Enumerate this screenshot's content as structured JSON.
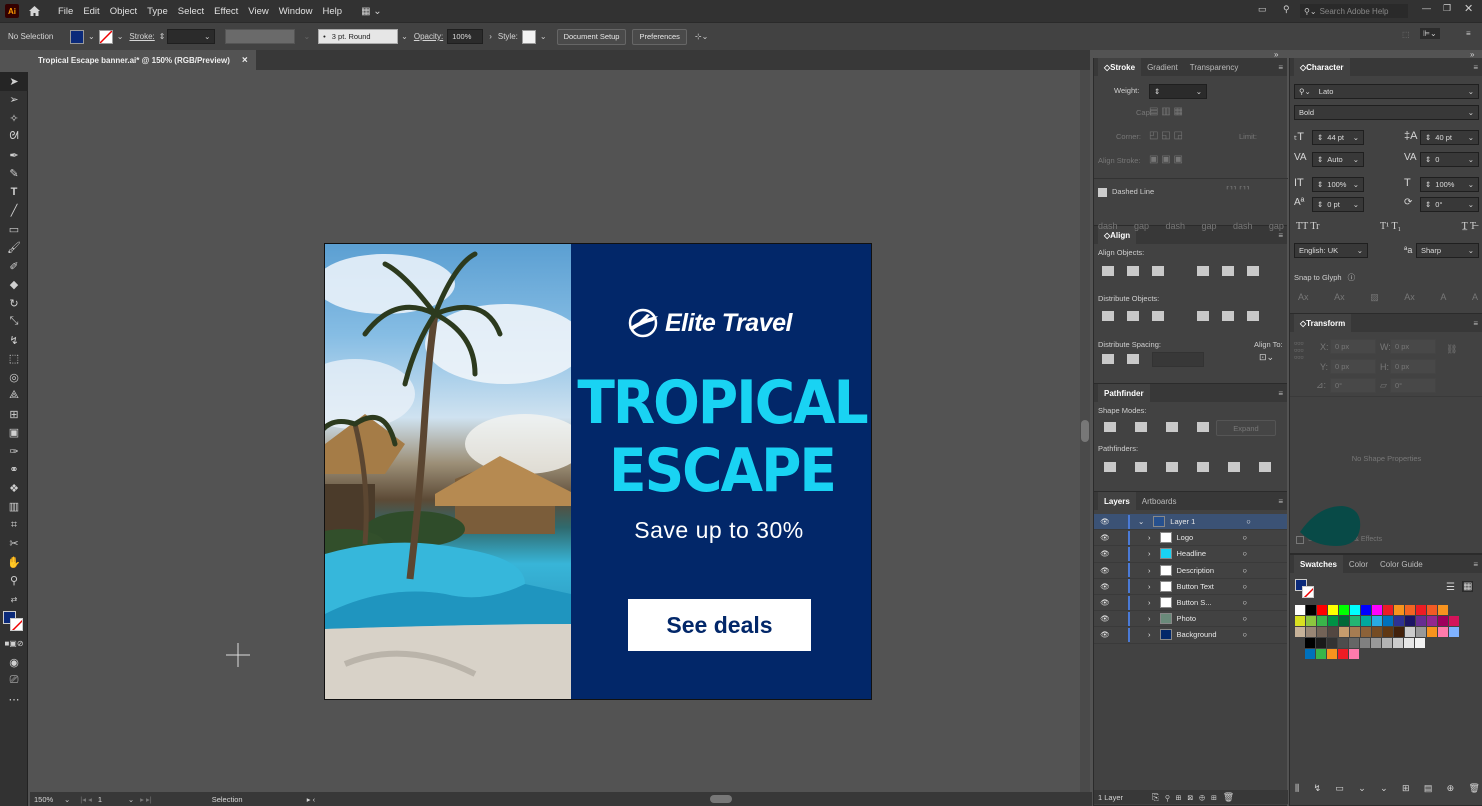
{
  "app": {
    "logo_text": "Ai"
  },
  "menu": [
    "File",
    "Edit",
    "Object",
    "Type",
    "Select",
    "Effect",
    "View",
    "Window",
    "Help"
  ],
  "search": {
    "placeholder": "Search Adobe Help"
  },
  "control_bar": {
    "selection_label": "No Selection",
    "stroke_label": "Stroke:",
    "brush": "3 pt. Round",
    "opacity_label": "Opacity:",
    "opacity_value": "100%",
    "style_label": "Style:",
    "document_setup": "Document Setup",
    "preferences": "Preferences",
    "fill_color": "#0b2a7a"
  },
  "document_tab": {
    "title": "Tropical Escape banner.ai* @ 150% (RGB/Preview)",
    "close": "×"
  },
  "banner": {
    "brand": "Elite Travel",
    "headline_line1": "TROPICAL",
    "headline_line2": "ESCAPE",
    "description": "Save up to 30%",
    "button_text": "See deals",
    "bg_color": "#022769",
    "headline_color": "#19d3f3"
  },
  "status": {
    "zoom": "150%",
    "artboard": "1",
    "tool": "Selection"
  },
  "stroke_panel": {
    "tabs": [
      "Stroke",
      "Gradient",
      "Transparency"
    ],
    "weight_label": "Weight:",
    "cap_label": "Cap:",
    "corner_label": "Corner:",
    "limit_label": "Limit:",
    "align_stroke_label": "Align Stroke:",
    "dashed_line": "Dashed Line",
    "dash_labels": [
      "dash",
      "gap",
      "dash",
      "gap",
      "dash",
      "gap"
    ]
  },
  "align_panel": {
    "title": "Align",
    "align_objects": "Align Objects:",
    "distribute_objects": "Distribute Objects:",
    "distribute_spacing": "Distribute Spacing:",
    "align_to": "Align To:"
  },
  "pathfinder_panel": {
    "title": "Pathfinder",
    "shape_modes": "Shape Modes:",
    "expand": "Expand",
    "pathfinders": "Pathfinders:"
  },
  "layers_panel": {
    "tabs": [
      "Layers",
      "Artboards"
    ],
    "layers": [
      {
        "name": "Layer 1",
        "level": 0
      },
      {
        "name": "Logo",
        "level": 1
      },
      {
        "name": "Headline",
        "level": 1
      },
      {
        "name": "Description",
        "level": 1
      },
      {
        "name": "Button Text",
        "level": 1
      },
      {
        "name": "Button S...",
        "level": 1
      },
      {
        "name": "Photo",
        "level": 1
      },
      {
        "name": "Background",
        "level": 1
      }
    ],
    "footer": "1 Layer"
  },
  "character_panel": {
    "title": "Character",
    "font_family": "Lato",
    "font_style": "Bold",
    "size": "44 pt",
    "leading": "40 pt",
    "kerning": "Auto",
    "tracking": "0",
    "vscale": "100%",
    "hscale": "100%",
    "baseline": "0 pt",
    "rotation": "0°",
    "language": "English: UK",
    "antialias": "Sharp",
    "snap_to_glyph": "Snap to Glyph"
  },
  "transform_panel": {
    "title": "Transform",
    "x_label": "X:",
    "y_label": "Y:",
    "w_label": "W:",
    "h_label": "H:",
    "x_val": "0 px",
    "y_val": "0 px",
    "w_val": "0 px",
    "h_val": "0 px",
    "angle": "0°",
    "shear": "0°",
    "no_props": "No Shape Properties",
    "scale_strokes": "Scale Corners & Effects"
  },
  "swatches_panel": {
    "tabs": [
      "Swatches",
      "Color",
      "Color Guide"
    ],
    "colors_row1": [
      "#ffffff",
      "#000000",
      "#ff0000",
      "#ffff00",
      "#00ff00",
      "#00ffff",
      "#0000ff",
      "#ff00ff",
      "#ec1c24",
      "#f7941d",
      "#f26522",
      "#ed1c24",
      "#f15a24",
      "#f7931e"
    ],
    "colors_row2": [
      "#d9e021",
      "#8cc63f",
      "#39b54a",
      "#009245",
      "#006837",
      "#22b573",
      "#00a99d",
      "#29abe2",
      "#0071bc",
      "#2e3192",
      "#1b1464",
      "#662d91",
      "#93278f",
      "#9e005d",
      "#d4145a"
    ],
    "colors_row3": [
      "#c7b299",
      "#998675",
      "#736357",
      "#534741",
      "#c69c6d",
      "#a67c52",
      "#8c6239",
      "#754c24",
      "#603813",
      "#42210b",
      "#cccccc",
      "#999999",
      "#f7931e",
      "#ff7bac",
      "#7fb2ff"
    ],
    "gray_row": [
      "#000000",
      "#1a1a1a",
      "#333333",
      "#4d4d4d",
      "#666666",
      "#808080",
      "#999999",
      "#b3b3b3",
      "#cccccc",
      "#e6e6e6",
      "#f2f2f2"
    ],
    "extra_row": [
      "#0071bc",
      "#39b54a",
      "#f7931e",
      "#ed1c24",
      "#ff7bac"
    ]
  }
}
